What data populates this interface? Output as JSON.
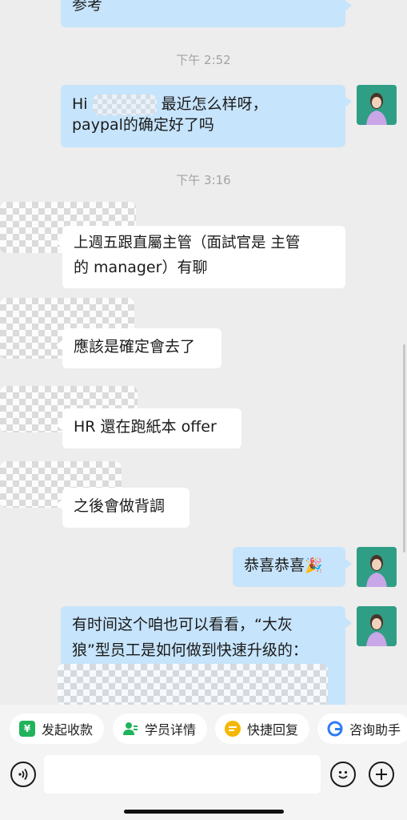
{
  "messages": {
    "m0_text": "参考",
    "time1": "下午 2:52",
    "m1_line1_pre": "Hi",
    "m1_line1_post": "最近怎么样呀，",
    "m1_line2": "paypal的确定好了吗",
    "time2": "下午 3:16",
    "m2_line1": "上週五跟直屬主管（面試官是 主管",
    "m2_line2": "的 manager）有聊",
    "m3_text": "應該是確定會去了",
    "m4_text": "HR 還在跑紙本 offer",
    "m5_text": "之後會做背調",
    "m6_text": "恭喜恭喜",
    "m6_emoji": "🎉",
    "m7_line1": "有时间这个咱也可以看看，“大灰",
    "m7_line2": "狼”型员工是如何做到快速升级的："
  },
  "quick_actions": [
    {
      "label": "发起收款",
      "icon": "yuan-icon",
      "color": "#21b35c"
    },
    {
      "label": "学员详情",
      "icon": "user-icon",
      "color": "#21b35c"
    },
    {
      "label": "快捷回复",
      "icon": "reply-icon",
      "color": "#f5b800"
    },
    {
      "label": "咨询助手",
      "icon": "g-icon",
      "color": "#2f7bf5"
    }
  ],
  "input": {
    "placeholder": ""
  },
  "colors": {
    "self_bubble": "#c6e4fb",
    "other_bubble": "#ffffff",
    "avatar_bg": "#2f9e85"
  }
}
